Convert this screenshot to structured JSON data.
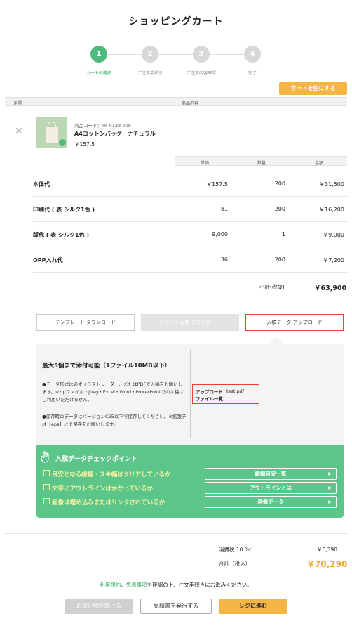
{
  "page_title": "ショッピングカート",
  "steps": [
    {
      "num": "1",
      "label": "カートの商品"
    },
    {
      "num": "2",
      "label": "ご注文手続き"
    },
    {
      "num": "3",
      "label": "ご注文内容確認"
    },
    {
      "num": "4",
      "label": "完了"
    }
  ],
  "empty_cart_label": "カートを空にする",
  "cart_header": {
    "delete": "削除",
    "content": "商品内容"
  },
  "product": {
    "code": "商品コード：TR-0128-008",
    "name": "A4コットンバッグ　ナチュラル",
    "price": "￥157.5"
  },
  "price_header": {
    "unit": "単価",
    "qty": "数量",
    "amount": "金額"
  },
  "price_rows": [
    {
      "label": "本体代",
      "unit": "￥157.5",
      "qty": "200",
      "amount": "￥31,500"
    },
    {
      "label": "印刷代 ( 表 シルク1色 )",
      "unit": "81",
      "qty": "200",
      "amount": "￥16,200"
    },
    {
      "label": "版代 ( 表 シルク1色 )",
      "unit": "9,000",
      "qty": "1",
      "amount": "￥9,000"
    },
    {
      "label": "OPP入れ代",
      "unit": "36",
      "qty": "200",
      "amount": "￥7,200"
    }
  ],
  "subtotal": {
    "label": "小計(税抜)",
    "value": "￥63,900"
  },
  "tabs": {
    "template": "テンプレート ダウンロード",
    "design": "デザイン画像 ダウンロード",
    "upload": "入稿データ アップロード"
  },
  "upload": {
    "heading": "最大5個まで添付可能（1ファイル10MB以下）",
    "note1": "●データ形式は必ずイラストレーター、またはPDFで入稿をお願いします。※zipファイル・jpeg・Excel・Word・PowerPointでの入稿はご利用いただけません。",
    "note2": "●保存時のデータはバージョンCS5以下で保存してください。※拡張子は【eps】にて保存をお願いします。",
    "list_label1": "アップロード",
    "list_label2": "ファイル一覧",
    "file_name": "test.pdf"
  },
  "check": {
    "title": "入稿データチェックポイント",
    "items": [
      {
        "text": "目安となる線幅・ヌキ幅はクリアしているか",
        "button": "線幅目安一覧"
      },
      {
        "text": "文字にアウトラインはかかっているか",
        "button": "アウトラインとは"
      },
      {
        "text": "画像は埋め込みまたはリンクされているか",
        "button": "画像データ"
      }
    ]
  },
  "tax": {
    "label": "消費税 10 %：",
    "value": "￥6,390"
  },
  "total": {
    "label": "合計（税込）",
    "value": "￥70,290"
  },
  "terms": {
    "link1": "利用規約",
    "sep": "、",
    "link2": "免責事項",
    "rest": "を確認の上、注文手続きにお進みください。"
  },
  "buttons": {
    "continue": "お買い物を続ける",
    "quote": "見積書を発行する",
    "checkout": "レジに進む"
  },
  "colors": {
    "accent_green": "#4fba7c",
    "orange": "#f3b544",
    "highlight_red": "#e8442a"
  }
}
